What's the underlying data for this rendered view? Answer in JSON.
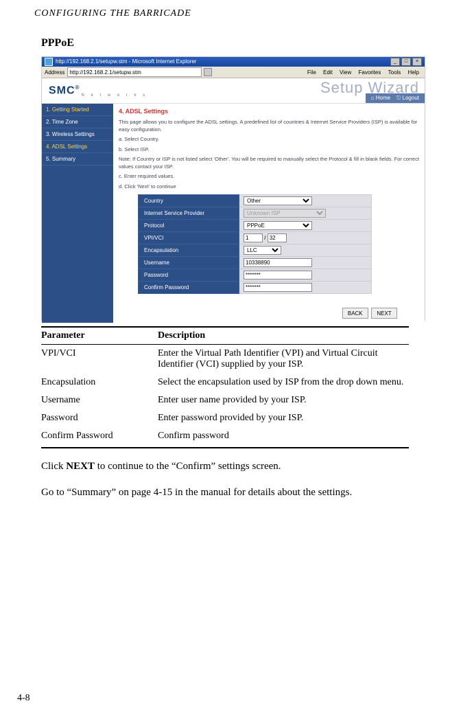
{
  "running_head": "CONFIGURING THE BARRICADE",
  "section_title": "PPPoE",
  "ie": {
    "title": "http://192.168.2.1/setupw.stm - Microsoft Internet Explorer",
    "addr_label": "Address",
    "url": "http://192.168.2.1/setupw.stm",
    "menu": [
      "File",
      "Edit",
      "View",
      "Favorites",
      "Tools",
      "Help"
    ],
    "min": "_",
    "max": "□",
    "close": "×"
  },
  "brand": {
    "logo": "SMC",
    "reg": "®",
    "networks": "N e t w o r k s",
    "wizard": "Setup Wizard",
    "home_icon": "⌂",
    "home": "Home",
    "logout_icon": "⎋",
    "logout": "Logout"
  },
  "sidebar": {
    "items": [
      "1. Getting Started",
      "2. Time Zone",
      "3. Wireless Settings",
      "4. ADSL Settings",
      "5. Summary"
    ]
  },
  "content": {
    "heading": "4. ADSL Settings",
    "p1": "This page allows you to configure the ADSL settings. A predefined list of countries & Internet Service Providers (ISP) is available for easy configuration.",
    "pa": "a. Select Country.",
    "pb": "b. Select ISP.",
    "note": "Note: If Country or ISP is not listed select 'Other'. You will be required to manually select the Protocol & fill in blank fields. For correct values contact your ISP.",
    "pc": "c. Enter required values.",
    "pd": "d. Click 'Next' to continue",
    "rows": [
      {
        "label": "Country",
        "type": "select",
        "value": "Other"
      },
      {
        "label": "Internet Service Provider",
        "type": "select",
        "value": "Unknown ISP",
        "disabled": true
      },
      {
        "label": "Protocol",
        "type": "select",
        "value": "PPPoE"
      },
      {
        "label": "VPI/VCI",
        "type": "vpivci",
        "v1": "1",
        "sep": "/",
        "v2": "32"
      },
      {
        "label": "Encapsulation",
        "type": "select",
        "value": "LLC",
        "narrow": true
      },
      {
        "label": "Username",
        "type": "text",
        "value": "10338890"
      },
      {
        "label": "Password",
        "type": "password",
        "value": "*******"
      },
      {
        "label": "Confirm Password",
        "type": "password",
        "value": "*******"
      }
    ],
    "back": "BACK",
    "next": "NEXT"
  },
  "table": {
    "head_param": "Parameter",
    "head_desc": "Description",
    "rows": [
      {
        "p": "VPI/VCI",
        "d": "Enter the Virtual Path Identifier (VPI) and Virtual Circuit Identifier (VCI) supplied by your ISP."
      },
      {
        "p": "Encapsulation",
        "d": "Select the encapsulation used by ISP from the drop down menu."
      },
      {
        "p": "Username",
        "d": "Enter user name provided by your ISP."
      },
      {
        "p": "Password",
        "d": "Enter password provided by your ISP."
      },
      {
        "p": "Confirm Password",
        "d": "Confirm password"
      }
    ]
  },
  "para1_a": "Click ",
  "para1_b": "NEXT",
  "para1_c": " to continue to the “Confirm” settings screen.",
  "para2": "Go to “Summary” on page 4-15 in the manual for details about the settings.",
  "page_num": "4-8"
}
